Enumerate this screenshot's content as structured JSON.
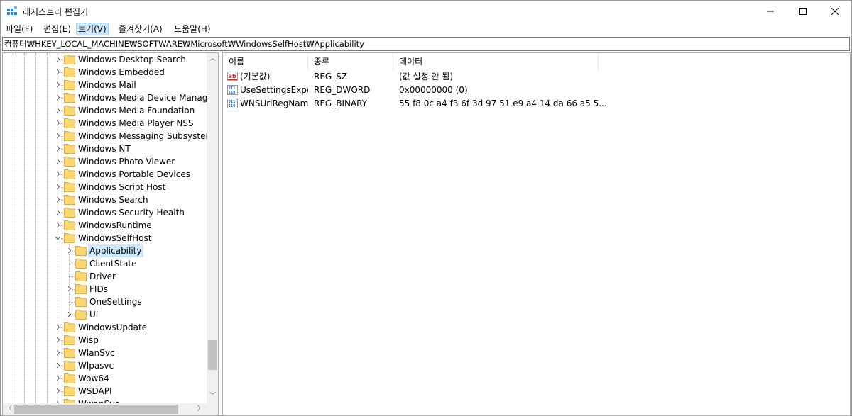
{
  "window": {
    "title": "레지스트리 편집기"
  },
  "menu": [
    "파일(F)",
    "편집(E)",
    "보기(V)",
    "즐겨찾기(A)",
    "도움말(H)"
  ],
  "address": "컴퓨터₩HKEY_LOCAL_MACHINE₩SOFTWARE₩Microsoft₩WindowsSelfHost₩Applicability",
  "tree": [
    "Windows Desktop Search",
    "Windows Embedded",
    "Windows Mail",
    "Windows Media Device Manager",
    "Windows Media Foundation",
    "Windows Media Player NSS",
    "Windows Messaging Subsystem",
    "Windows NT",
    "Windows Photo Viewer",
    "Windows Portable Devices",
    "Windows Script Host",
    "Windows Search",
    "Windows Security Health",
    "WindowsRuntime",
    "WindowsSelfHost",
    "Applicability",
    "ClientState",
    "Driver",
    "FIDs",
    "OneSettings",
    "UI",
    "WindowsUpdate",
    "Wisp",
    "WlanSvc",
    "Wlpasvc",
    "Wow64",
    "WSDAPI",
    "WwanSvc"
  ],
  "columns": [
    "이름",
    "종류",
    "데이터"
  ],
  "values": [
    {
      "name": "(기본값)",
      "type": "REG_SZ",
      "data": "(값 설정 안 됨)",
      "icon": "string-value-icon"
    },
    {
      "name": "UseSettingsExpe...",
      "type": "REG_DWORD",
      "data": "0x00000000 (0)",
      "icon": "binary-value-icon"
    },
    {
      "name": "WNSUriRegName",
      "type": "REG_BINARY",
      "data": "55 f8 0c a4 f3 6f 3d 97 51 e9 a4 14 da 66 a5 5...",
      "icon": "binary-value-icon"
    }
  ],
  "colors": {
    "selection": "#cce8ff",
    "folder": "#f8d775",
    "accent": "#0078d7"
  }
}
